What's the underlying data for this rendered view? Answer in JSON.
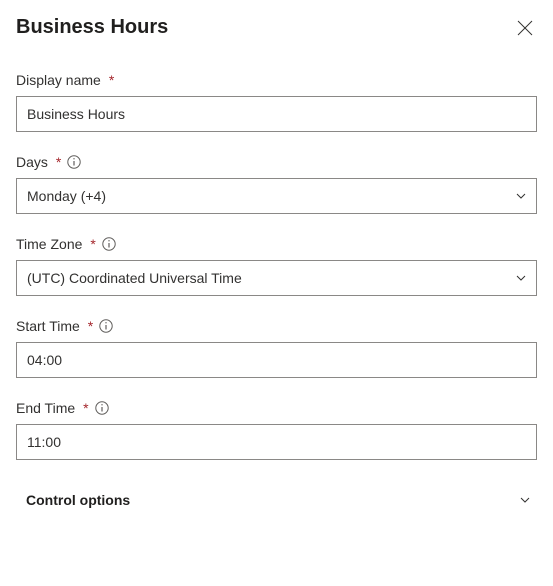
{
  "header": {
    "title": "Business Hours"
  },
  "fields": {
    "displayName": {
      "label": "Display name",
      "value": "Business Hours"
    },
    "days": {
      "label": "Days",
      "value": "Monday (+4)"
    },
    "timeZone": {
      "label": "Time Zone",
      "value": "(UTC) Coordinated Universal Time"
    },
    "startTime": {
      "label": "Start Time",
      "value": "04:00"
    },
    "endTime": {
      "label": "End Time",
      "value": "11:00"
    }
  },
  "section": {
    "controlOptions": "Control options"
  }
}
